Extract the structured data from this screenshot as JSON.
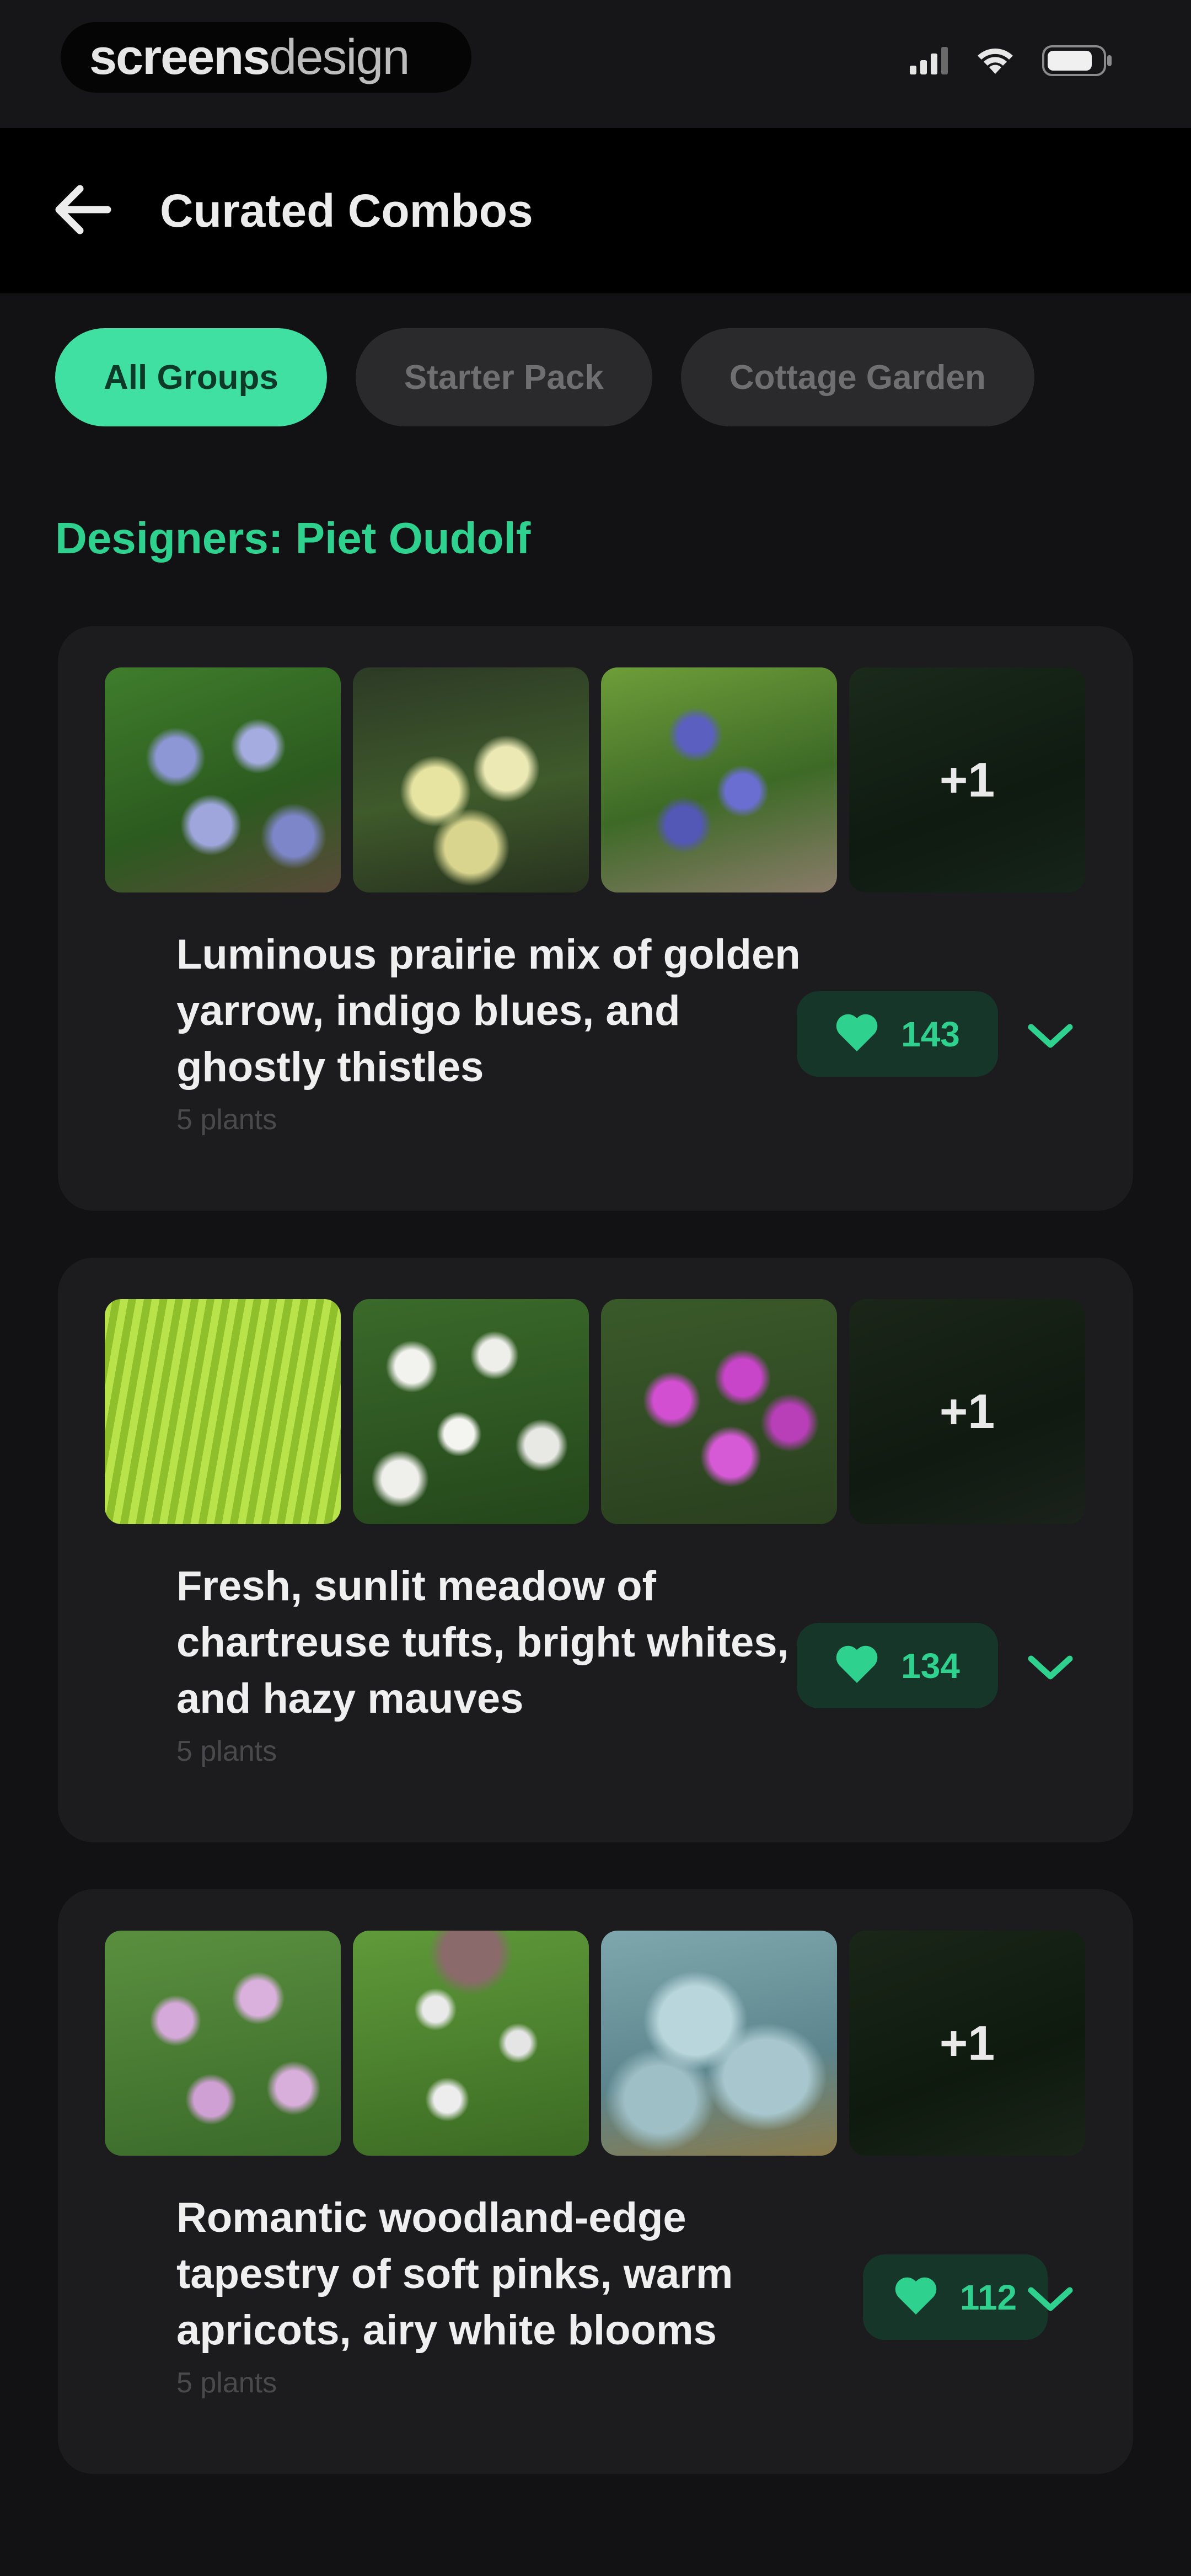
{
  "status_bar": {
    "brand_bold": "screens",
    "brand_light": "design",
    "icons": [
      "signal-icon",
      "wifi-icon",
      "battery-icon"
    ]
  },
  "header": {
    "title": "Curated Combos",
    "back_icon": "arrow-left-icon"
  },
  "filters": {
    "chips": [
      {
        "label": "All Groups",
        "active": true
      },
      {
        "label": "Starter Pack",
        "active": false
      },
      {
        "label": "Cottage Garden",
        "active": false
      }
    ]
  },
  "section": {
    "title": "Designers: Piet Oudolf"
  },
  "colors": {
    "accent": "#3fe0a2",
    "accent_text": "#2fd18e",
    "background": "#121214",
    "card": "#1c1c1f"
  },
  "combos": [
    {
      "title": "Luminous prairie mix of golden yarrow, indigo blues, and ghostly thistles",
      "meta": "5 plants",
      "likes": "143",
      "more_count": "+1"
    },
    {
      "title": "Fresh, sunlit meadow of chartreuse tufts, bright whites, and hazy mauves",
      "meta": "5 plants",
      "likes": "134",
      "more_count": "+1"
    },
    {
      "title": "Romantic woodland-edge tapestry of soft pinks, warm apricots, airy white blooms",
      "meta": "5 plants",
      "likes": "112",
      "more_count": "+1"
    }
  ]
}
